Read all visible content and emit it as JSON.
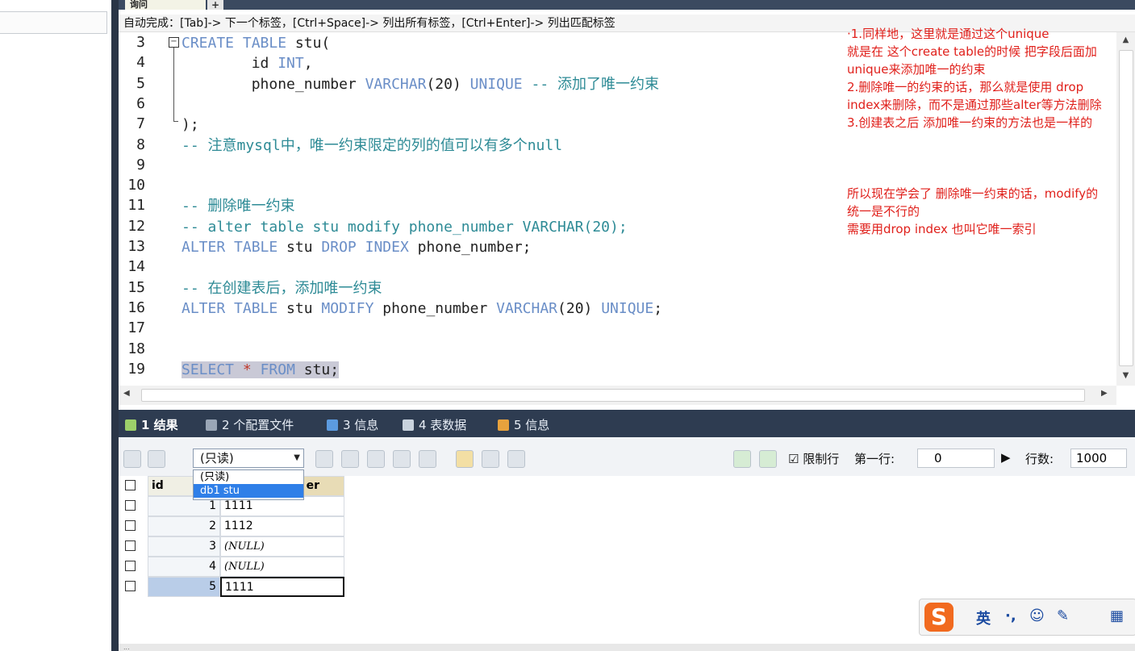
{
  "editor_tab": {
    "label": "询问",
    "add_label": "+"
  },
  "hint": "自动完成：[Tab]-> 下一个标签，[Ctrl+Space]-> 列出所有标签，[Ctrl+Enter]-> 列出匹配标签",
  "code_lines": [
    {
      "n": "3",
      "segs": [
        {
          "k": "kw",
          "t": "CREATE"
        },
        {
          "k": "",
          "t": " "
        },
        {
          "k": "kw",
          "t": "TABLE"
        },
        {
          "k": "",
          "t": " stu("
        }
      ]
    },
    {
      "n": "4",
      "segs": [
        {
          "k": "",
          "t": "        id "
        },
        {
          "k": "kw",
          "t": "INT"
        },
        {
          "k": "",
          "t": ","
        }
      ]
    },
    {
      "n": "5",
      "segs": [
        {
          "k": "",
          "t": "        phone_number "
        },
        {
          "k": "kw",
          "t": "VARCHAR"
        },
        {
          "k": "",
          "t": "(20) "
        },
        {
          "k": "kw",
          "t": "UNIQUE"
        },
        {
          "k": "",
          "t": " "
        },
        {
          "k": "cm",
          "t": "-- 添加了唯一约束"
        }
      ]
    },
    {
      "n": "6",
      "segs": []
    },
    {
      "n": "7",
      "segs": [
        {
          "k": "",
          "t": ");"
        }
      ]
    },
    {
      "n": "8",
      "segs": [
        {
          "k": "cm",
          "t": "-- 注意mysql中，唯一约束限定的列的值可以有多个null"
        }
      ]
    },
    {
      "n": "9",
      "segs": []
    },
    {
      "n": "10",
      "segs": []
    },
    {
      "n": "11",
      "segs": [
        {
          "k": "cm",
          "t": "-- 删除唯一约束"
        }
      ]
    },
    {
      "n": "12",
      "segs": [
        {
          "k": "cm",
          "t": "-- alter table stu modify phone_number VARCHAR(20);"
        }
      ]
    },
    {
      "n": "13",
      "segs": [
        {
          "k": "kw",
          "t": "ALTER"
        },
        {
          "k": "",
          "t": " "
        },
        {
          "k": "kw",
          "t": "TABLE"
        },
        {
          "k": "",
          "t": " stu "
        },
        {
          "k": "kw",
          "t": "DROP"
        },
        {
          "k": "",
          "t": " "
        },
        {
          "k": "kw",
          "t": "INDEX"
        },
        {
          "k": "",
          "t": " phone_number;"
        }
      ]
    },
    {
      "n": "14",
      "segs": []
    },
    {
      "n": "15",
      "segs": [
        {
          "k": "cm",
          "t": "-- 在创建表后，添加唯一约束"
        }
      ]
    },
    {
      "n": "16",
      "segs": [
        {
          "k": "kw",
          "t": "ALTER"
        },
        {
          "k": "",
          "t": " "
        },
        {
          "k": "kw",
          "t": "TABLE"
        },
        {
          "k": "",
          "t": " stu "
        },
        {
          "k": "kw",
          "t": "MODIFY"
        },
        {
          "k": "",
          "t": " phone_number "
        },
        {
          "k": "kw",
          "t": "VARCHAR"
        },
        {
          "k": "",
          "t": "(20) "
        },
        {
          "k": "kw",
          "t": "UNIQUE"
        },
        {
          "k": "",
          "t": ";"
        }
      ]
    },
    {
      "n": "17",
      "segs": []
    },
    {
      "n": "18",
      "segs": []
    },
    {
      "n": "19",
      "segs": [
        {
          "k": "kw sel",
          "t": "SELECT"
        },
        {
          "k": "sel",
          "t": " "
        },
        {
          "k": "sel star",
          "t": "*"
        },
        {
          "k": "sel",
          "t": " "
        },
        {
          "k": "kw sel",
          "t": "FROM"
        },
        {
          "k": "sel",
          "t": " stu;"
        }
      ]
    }
  ],
  "notes_top": [
    "·1.同样地，这里就是通过这个unique",
    " 就是在 这个create table的时候 把字段后面加",
    " unique来添加唯一的约束",
    " 2.删除唯一的约束的话，那么就是使用 drop",
    " index来删除，而不是通过那些alter等方法删除",
    " 3.创建表之后 添加唯一约束的方法也是一样的"
  ],
  "notes_bottom": [
    "所以现在学会了  删除唯一约束的话，modify的",
    "统一是不行的",
    "需要用drop index  也叫它唯一索引"
  ],
  "result_tabs": [
    {
      "label": "1 结果",
      "active": true,
      "icon": "results-icon"
    },
    {
      "label": "2 个配置文件",
      "active": false,
      "icon": "profile-icon"
    },
    {
      "label": "3 信息",
      "active": false,
      "icon": "info-icon"
    },
    {
      "label": "4 表数据",
      "active": false,
      "icon": "table-data-icon"
    },
    {
      "label": "5 信息",
      "active": false,
      "icon": "info2-icon"
    }
  ],
  "toolbar": {
    "readonly_value": "(只读)",
    "dropdown_options": [
      "(只读)",
      "db1   stu"
    ],
    "limit_checkbox": "限制行",
    "first_row_label": "第一行:",
    "first_row_value": "0",
    "rows_label": "行数:",
    "rows_value": "1000"
  },
  "grid": {
    "columns": [
      "id",
      "phone_number"
    ],
    "header_visible_b": "er",
    "rows": [
      {
        "id": "1",
        "phone": "1111",
        "null": false
      },
      {
        "id": "2",
        "phone": "1112",
        "null": false
      },
      {
        "id": "3",
        "phone": "(NULL)",
        "null": true
      },
      {
        "id": "4",
        "phone": "(NULL)",
        "null": true
      },
      {
        "id": "5",
        "phone": "1111",
        "null": false
      }
    ]
  },
  "ime": {
    "logo": "S",
    "lang": "英",
    "punct": "·,",
    "emoji": "☺"
  },
  "status": "...",
  "colors": {
    "keyword": "#6a8ec7",
    "comment": "#2e8b96",
    "note": "#e0201b",
    "tabbar": "#2e3c51"
  }
}
